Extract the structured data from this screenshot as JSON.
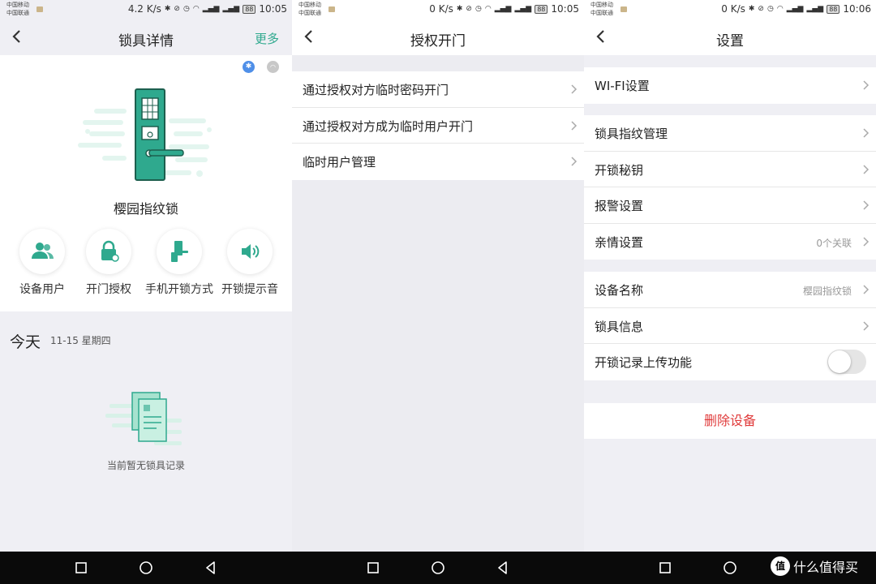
{
  "status_bars": [
    {
      "carrier1": "中国移动",
      "carrier2": "中国联通",
      "speed": "4.2 K/s",
      "battery": "88",
      "time": "10:05"
    },
    {
      "carrier1": "中国移动",
      "carrier2": "中国联通",
      "speed": "0 K/s",
      "battery": "88",
      "time": "10:05"
    },
    {
      "carrier1": "中国移动",
      "carrier2": "中国联通",
      "speed": "0 K/s",
      "battery": "88",
      "time": "10:06"
    }
  ],
  "screen1": {
    "title": "锁具详情",
    "more": "更多",
    "lock_name": "樱园指纹锁",
    "features": [
      {
        "label": "设备用户",
        "icon": "users-icon"
      },
      {
        "label": "开门授权",
        "icon": "lock-auth-icon"
      },
      {
        "label": "手机开锁方式",
        "icon": "phone-unlock-icon"
      },
      {
        "label": "开锁提示音",
        "icon": "speaker-icon"
      }
    ],
    "today": "今天",
    "date": "11-15 星期四",
    "empty_text": "当前暂无锁具记录"
  },
  "screen2": {
    "title": "授权开门",
    "items": [
      {
        "label": "通过授权对方临时密码开门"
      },
      {
        "label": "通过授权对方成为临时用户开门"
      },
      {
        "label": "临时用户管理"
      }
    ]
  },
  "screen3": {
    "title": "设置",
    "group1": [
      {
        "label": "WI-FI设置",
        "value": ""
      }
    ],
    "group2": [
      {
        "label": "锁具指纹管理",
        "value": ""
      },
      {
        "label": "开锁秘钥",
        "value": ""
      },
      {
        "label": "报警设置",
        "value": ""
      },
      {
        "label": "亲情设置",
        "value": "0个关联"
      }
    ],
    "group3": [
      {
        "label": "设备名称",
        "value": "樱园指纹锁"
      },
      {
        "label": "锁具信息",
        "value": ""
      }
    ],
    "upload_label": "开锁记录上传功能",
    "upload_enabled": false,
    "delete": "删除设备"
  },
  "watermark": {
    "logo": "值",
    "text": "什么值得买"
  },
  "colors": {
    "accent": "#2fa98e",
    "danger": "#e03b3b",
    "bluetooth": "#4f8fe8"
  }
}
